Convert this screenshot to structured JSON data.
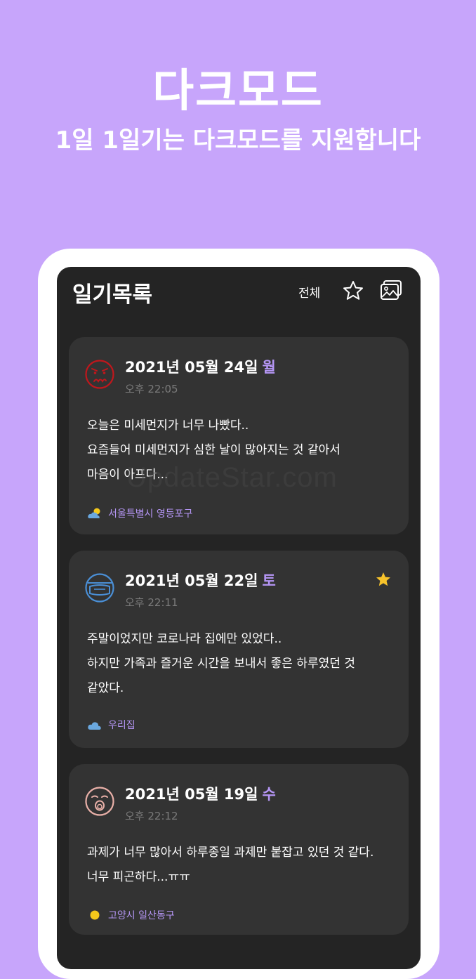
{
  "promo": {
    "title": "다크모드",
    "subtitle": "1일 1일기는 다크모드를 지원합니다"
  },
  "app": {
    "title": "일기목록",
    "filter_label": "전체",
    "favorites_icon": "star-outline-icon",
    "gallery_icon": "gallery-icon"
  },
  "entries": [
    {
      "date": "2021년 05월 24일",
      "weekday": "월",
      "time": "오후 22:05",
      "mood_icon": "angry-face-icon",
      "favorite": false,
      "body": [
        "오늘은 미세먼지가 너무 나빴다..",
        "요즘들어 미세먼지가 심한 날이 많아지는 것 같아서",
        "마음이 아프다..."
      ],
      "location": "서울특별시 영등포구",
      "weather_icon": "partly-cloudy-icon"
    },
    {
      "date": "2021년 05월 22일",
      "weekday": "토",
      "time": "오후 22:11",
      "mood_icon": "masked-face-icon",
      "favorite": true,
      "body": [
        "주말이었지만 코로나라 집에만 있었다..",
        "하지만 가족과 즐거운 시간을 보내서 좋은 하루였던 것",
        "같았다."
      ],
      "location": "우리집",
      "weather_icon": "cloud-icon"
    },
    {
      "date": "2021년 05월 19일",
      "weekday": "수",
      "time": "오후 22:12",
      "mood_icon": "surprised-face-icon",
      "favorite": false,
      "body": [
        "과제가 너무 많아서 하루종일 과제만 붙잡고 있던 것 같다.",
        "너무 피곤하다...ㅠㅠ"
      ],
      "location": "고양시 일산동구",
      "weather_icon": "sun-icon"
    }
  ],
  "watermark": "UpdateStar.com",
  "colors": {
    "background": "#c7a5fb",
    "screen": "#242424",
    "card": "#333333",
    "accent": "#b596f5",
    "angry": "#c0171c",
    "mask": "#4a8fd6",
    "surprised": "#e9b0a8",
    "star": "#f7c32b",
    "sun": "#f4c81b"
  }
}
